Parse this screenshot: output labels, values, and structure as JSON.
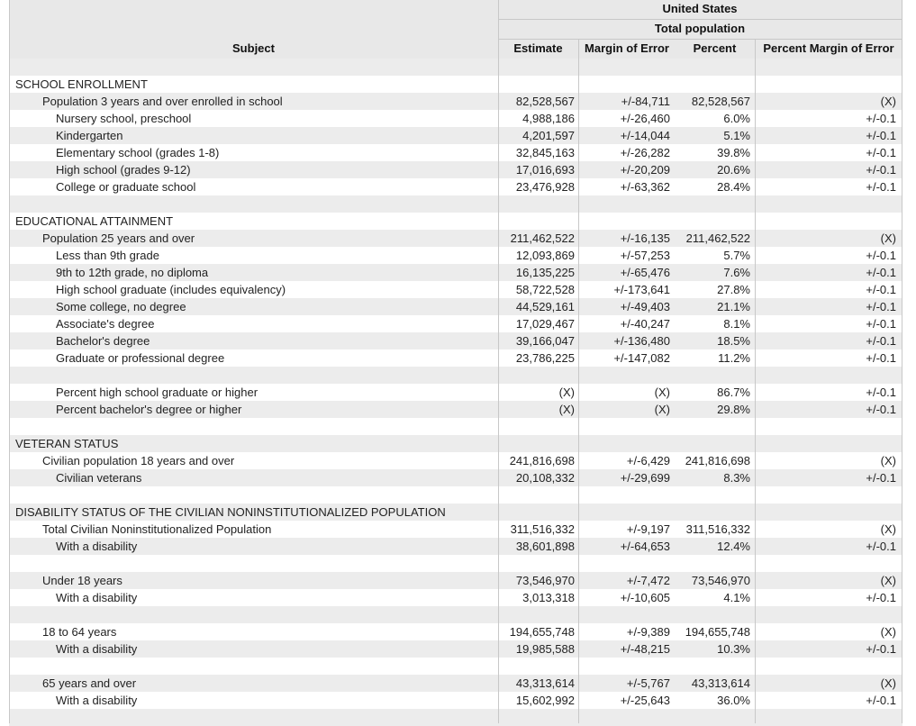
{
  "header": {
    "geo": "United States",
    "population": "Total population",
    "subject": "Subject",
    "columns": [
      "Estimate",
      "Margin of Error",
      "Percent",
      "Percent Margin of Error"
    ]
  },
  "rows": [
    {
      "type": "blank"
    },
    {
      "type": "section",
      "label": "SCHOOL ENROLLMENT"
    },
    {
      "type": "data",
      "level": 1,
      "label": "Population 3 years and over enrolled in school",
      "estimate": "82,528,567",
      "moe": "+/-84,711",
      "percent": "82,528,567",
      "pmoe": "(X)"
    },
    {
      "type": "data",
      "level": 2,
      "label": "Nursery school, preschool",
      "estimate": "4,988,186",
      "moe": "+/-26,460",
      "percent": "6.0%",
      "pmoe": "+/-0.1"
    },
    {
      "type": "data",
      "level": 2,
      "label": "Kindergarten",
      "estimate": "4,201,597",
      "moe": "+/-14,044",
      "percent": "5.1%",
      "pmoe": "+/-0.1"
    },
    {
      "type": "data",
      "level": 2,
      "label": "Elementary school (grades 1-8)",
      "estimate": "32,845,163",
      "moe": "+/-26,282",
      "percent": "39.8%",
      "pmoe": "+/-0.1"
    },
    {
      "type": "data",
      "level": 2,
      "label": "High school (grades 9-12)",
      "estimate": "17,016,693",
      "moe": "+/-20,209",
      "percent": "20.6%",
      "pmoe": "+/-0.1"
    },
    {
      "type": "data",
      "level": 2,
      "label": "College or graduate school",
      "estimate": "23,476,928",
      "moe": "+/-63,362",
      "percent": "28.4%",
      "pmoe": "+/-0.1"
    },
    {
      "type": "blank"
    },
    {
      "type": "section",
      "label": "EDUCATIONAL ATTAINMENT"
    },
    {
      "type": "data",
      "level": 1,
      "label": "Population 25 years and over",
      "estimate": "211,462,522",
      "moe": "+/-16,135",
      "percent": "211,462,522",
      "pmoe": "(X)"
    },
    {
      "type": "data",
      "level": 2,
      "label": "Less than 9th grade",
      "estimate": "12,093,869",
      "moe": "+/-57,253",
      "percent": "5.7%",
      "pmoe": "+/-0.1"
    },
    {
      "type": "data",
      "level": 2,
      "label": "9th to 12th grade, no diploma",
      "estimate": "16,135,225",
      "moe": "+/-65,476",
      "percent": "7.6%",
      "pmoe": "+/-0.1"
    },
    {
      "type": "data",
      "level": 2,
      "label": "High school graduate (includes equivalency)",
      "estimate": "58,722,528",
      "moe": "+/-173,641",
      "percent": "27.8%",
      "pmoe": "+/-0.1"
    },
    {
      "type": "data",
      "level": 2,
      "label": "Some college, no degree",
      "estimate": "44,529,161",
      "moe": "+/-49,403",
      "percent": "21.1%",
      "pmoe": "+/-0.1"
    },
    {
      "type": "data",
      "level": 2,
      "label": "Associate's degree",
      "estimate": "17,029,467",
      "moe": "+/-40,247",
      "percent": "8.1%",
      "pmoe": "+/-0.1"
    },
    {
      "type": "data",
      "level": 2,
      "label": "Bachelor's degree",
      "estimate": "39,166,047",
      "moe": "+/-136,480",
      "percent": "18.5%",
      "pmoe": "+/-0.1"
    },
    {
      "type": "data",
      "level": 2,
      "label": "Graduate or professional degree",
      "estimate": "23,786,225",
      "moe": "+/-147,082",
      "percent": "11.2%",
      "pmoe": "+/-0.1"
    },
    {
      "type": "blank"
    },
    {
      "type": "data",
      "level": 2,
      "label": "Percent high school graduate or higher",
      "estimate": "(X)",
      "moe": "(X)",
      "percent": "86.7%",
      "pmoe": "+/-0.1"
    },
    {
      "type": "data",
      "level": 2,
      "label": "Percent bachelor's degree or higher",
      "estimate": "(X)",
      "moe": "(X)",
      "percent": "29.8%",
      "pmoe": "+/-0.1"
    },
    {
      "type": "blank"
    },
    {
      "type": "section",
      "label": "VETERAN STATUS"
    },
    {
      "type": "data",
      "level": 1,
      "label": "Civilian population 18 years and over",
      "estimate": "241,816,698",
      "moe": "+/-6,429",
      "percent": "241,816,698",
      "pmoe": "(X)"
    },
    {
      "type": "data",
      "level": 2,
      "label": "Civilian veterans",
      "estimate": "20,108,332",
      "moe": "+/-29,699",
      "percent": "8.3%",
      "pmoe": "+/-0.1"
    },
    {
      "type": "blank"
    },
    {
      "type": "section",
      "label": "DISABILITY STATUS OF THE CIVILIAN NONINSTITUTIONALIZED POPULATION"
    },
    {
      "type": "data",
      "level": 1,
      "label": "Total Civilian Noninstitutionalized Population",
      "estimate": "311,516,332",
      "moe": "+/-9,197",
      "percent": "311,516,332",
      "pmoe": "(X)"
    },
    {
      "type": "data",
      "level": 2,
      "label": "With a disability",
      "estimate": "38,601,898",
      "moe": "+/-64,653",
      "percent": "12.4%",
      "pmoe": "+/-0.1"
    },
    {
      "type": "blank"
    },
    {
      "type": "data",
      "level": 1,
      "label": "Under 18 years",
      "estimate": "73,546,970",
      "moe": "+/-7,472",
      "percent": "73,546,970",
      "pmoe": "(X)"
    },
    {
      "type": "data",
      "level": 2,
      "label": "With a disability",
      "estimate": "3,013,318",
      "moe": "+/-10,605",
      "percent": "4.1%",
      "pmoe": "+/-0.1"
    },
    {
      "type": "blank"
    },
    {
      "type": "data",
      "level": 1,
      "label": "18 to 64 years",
      "estimate": "194,655,748",
      "moe": "+/-9,389",
      "percent": "194,655,748",
      "pmoe": "(X)"
    },
    {
      "type": "data",
      "level": 2,
      "label": "With a disability",
      "estimate": "19,985,588",
      "moe": "+/-48,215",
      "percent": "10.3%",
      "pmoe": "+/-0.1"
    },
    {
      "type": "blank"
    },
    {
      "type": "data",
      "level": 1,
      "label": "65 years and over",
      "estimate": "43,313,614",
      "moe": "+/-5,767",
      "percent": "43,313,614",
      "pmoe": "(X)"
    },
    {
      "type": "data",
      "level": 2,
      "label": "With a disability",
      "estimate": "15,602,992",
      "moe": "+/-25,643",
      "percent": "36.0%",
      "pmoe": "+/-0.1"
    },
    {
      "type": "blank"
    }
  ]
}
